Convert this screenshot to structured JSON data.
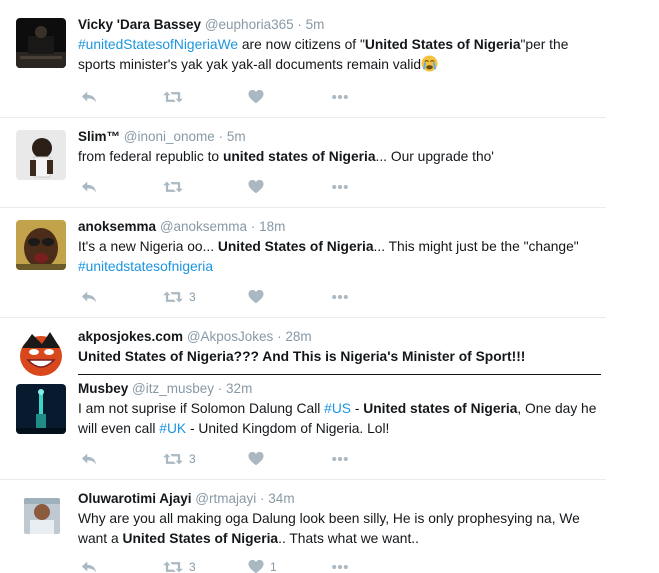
{
  "tweets": [
    {
      "fullname": "Vicky 'Dara Bassey",
      "username": "@euphoria365",
      "sep": "·",
      "time": "5m",
      "t1": "#unitedStatesofNigeriaWe",
      "t2": " are now citizens of \"",
      "t3": "United States of Nigeria",
      "t4": "\"per the sports minister's yak yak yak-all documents remain valid",
      "emoji": "crying-face-emoji"
    },
    {
      "fullname": "Slim™",
      "username": "@inoni_onome",
      "sep": "·",
      "time": "5m",
      "t1": "from federal republic to ",
      "t2": "united states of Nigeria",
      "t3": "... Our upgrade tho'"
    },
    {
      "fullname": "anoksemma",
      "username": "@anoksemma",
      "sep": "·",
      "time": "18m",
      "t1": "It's a new Nigeria oo...  ",
      "t2": "United States of Nigeria",
      "t3": "... This might just be the \"change\" ",
      "t4": "#unitedstatesofnigeria",
      "retweets": "3"
    },
    {
      "fullname": "akposjokes.com",
      "username": "@AkposJokes",
      "sep": "·",
      "time": "28m",
      "t1": "United States of Nigeria",
      "t2": "??? And This is Nigeria's Minister of Sport!!!"
    },
    {
      "fullname": "Musbey",
      "username": "@itz_musbey",
      "sep": "·",
      "time": "32m",
      "t1": "I am not suprise if Solomon Dalung Call ",
      "t2": "#US",
      "t3": " - ",
      "t4": "United states of Nigeria",
      "t5": ", One day he will even call ",
      "t6": "#UK",
      "t7": " - United Kingdom of Nigeria. Lol!",
      "retweets": "3"
    },
    {
      "fullname": "Oluwarotimi Ajayi",
      "username": "@rtmajayi",
      "sep": "·",
      "time": "34m",
      "t1": "Why are you all making oga Dalung look been silly, He is only prophesying na, We want a ",
      "t2": "United States of Nigeria",
      "t3": ".. Thats what we want..",
      "retweets": "3",
      "likes": "1"
    }
  ],
  "colors": {
    "accent": "#1b95e0",
    "muted": "#8899a6",
    "icon": "#aab8c2",
    "text": "#14171a",
    "border": "#e6ecf0"
  }
}
